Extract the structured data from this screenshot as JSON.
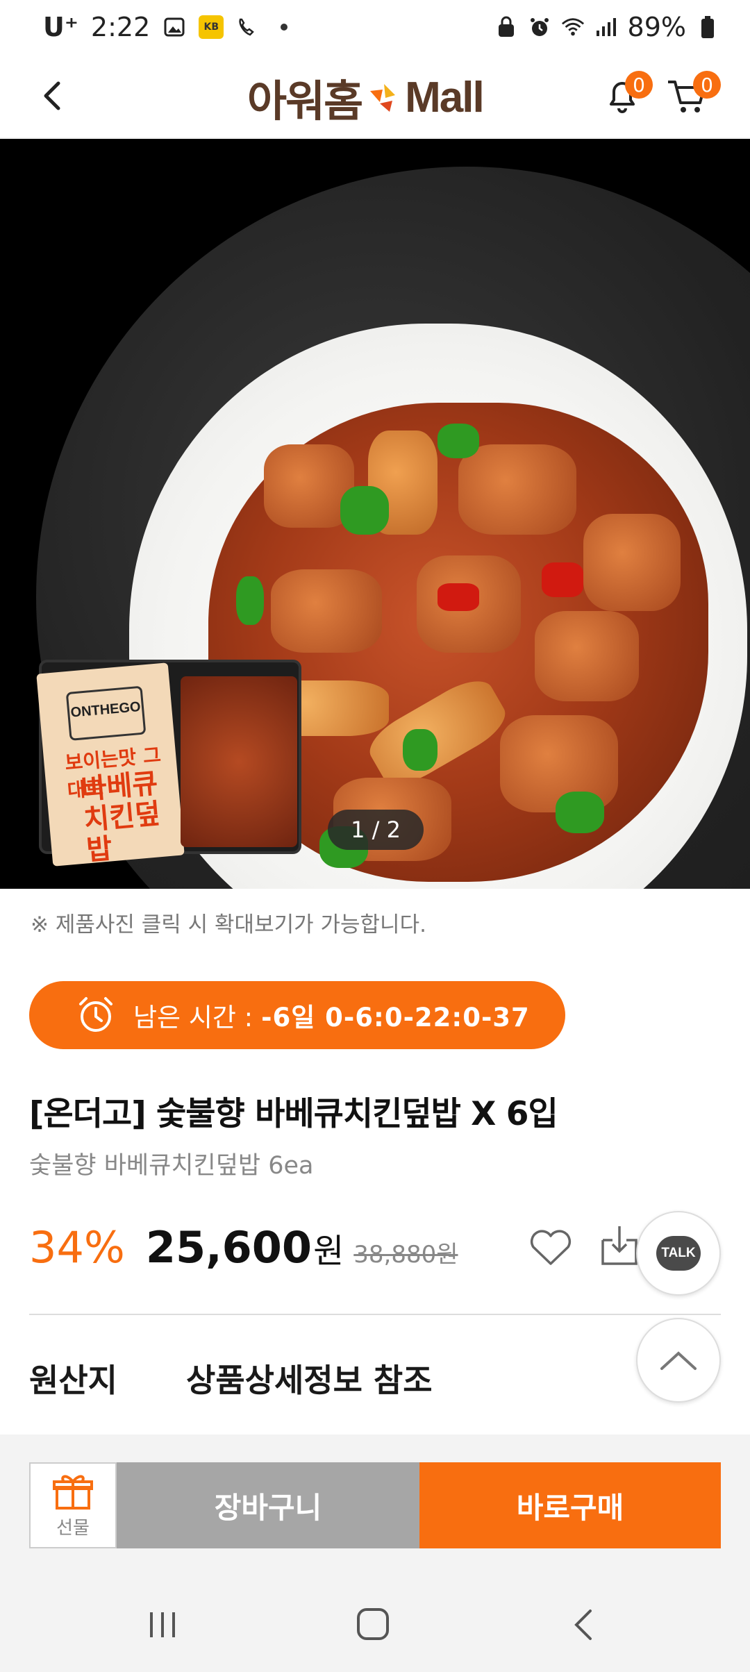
{
  "status_bar": {
    "carrier": "U⁺",
    "time": "2:22",
    "battery": "89%",
    "icons": [
      "gallery-icon",
      "kakao-icon",
      "whowho-icon",
      "dot-icon",
      "secure-icon",
      "alarm-icon",
      "wifi-icon",
      "signal-icon",
      "battery-icon"
    ]
  },
  "header": {
    "logo_korean": "아워홈",
    "logo_mall": "Mall",
    "notification_count": "0",
    "cart_count": "0"
  },
  "hero": {
    "pager": "1 / 2",
    "package_brand": "ONTHEGO",
    "package_tag": "보이는맛 그대로",
    "package_name": "바베큐 치킨덮밥"
  },
  "notice": "※ 제품사진 클릭 시 확대보기가 가능합니다.",
  "timer": {
    "label": "남은 시간 :",
    "value": "-6일 0-6:0-22:0-37"
  },
  "product": {
    "title": "[온더고] 숯불향 바베큐치킨덮밥 X 6입",
    "subtitle": "숯불향 바베큐치킨덮밥 6ea",
    "discount": "34%",
    "price": "25,600",
    "currency": "원",
    "original_price": "38,880원"
  },
  "talk_label": "TALK",
  "origin": {
    "label": "원산지",
    "value": "상품상세정보 참조"
  },
  "actions": {
    "gift": "선물",
    "cart": "장바구니",
    "buy": "바로구매"
  },
  "colors": {
    "accent": "#f86e10",
    "brand_brown": "#5a3a27",
    "cart_gray": "#a6a6a6"
  }
}
